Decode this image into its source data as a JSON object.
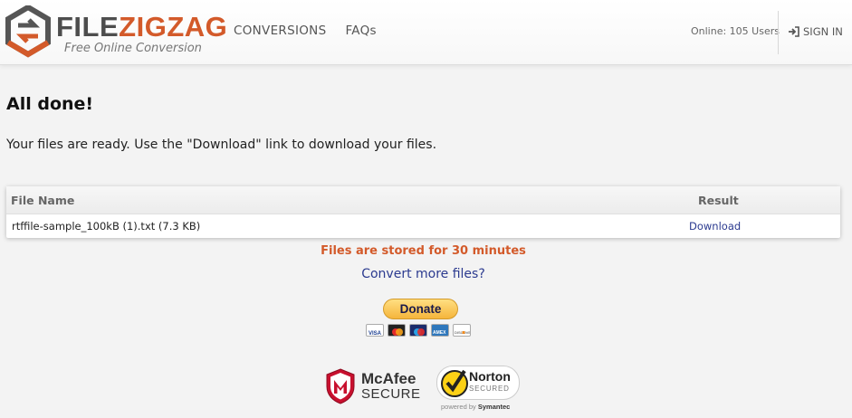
{
  "header": {
    "logo": {
      "title_part1": "FILE",
      "title_part2": "ZIGZAG",
      "tagline": "Free Online Conversion"
    },
    "nav": [
      {
        "label": "CONVERSIONS"
      },
      {
        "label": "FAQs"
      }
    ],
    "online_users": "Online: 105 Users",
    "sign_in": "SIGN IN"
  },
  "main": {
    "title": "All done!",
    "subtitle": "Your files are ready. Use the \"Download\" link to download your files.",
    "table": {
      "columns": [
        "File Name",
        "Result"
      ],
      "rows": [
        {
          "file_name": "rtffile-sample_100kB (1).txt (7.3 KB)",
          "result": "Download"
        }
      ]
    },
    "storage_notice": "Files are stored for 30 minutes",
    "convert_more": "Convert more files?",
    "donate": {
      "label": "Donate",
      "cards": [
        "VISA",
        "mastercard",
        "maestro",
        "AMEX",
        "DISCOVER"
      ]
    },
    "badges": {
      "mcafee": {
        "name": "McAfee",
        "sub": "SECURE"
      },
      "norton": {
        "name": "Norton",
        "sub": "SECURED",
        "powered_prefix": "powered by",
        "powered_by": "Symantec"
      }
    }
  },
  "colors": {
    "accent_orange": "#d35a2a",
    "link_blue": "#2b3a8f",
    "background": "#f3f3f3"
  },
  "icons": [
    "filezigzag-logo-icon",
    "sign-in-icon",
    "mcafee-shield-icon",
    "norton-check-icon"
  ]
}
